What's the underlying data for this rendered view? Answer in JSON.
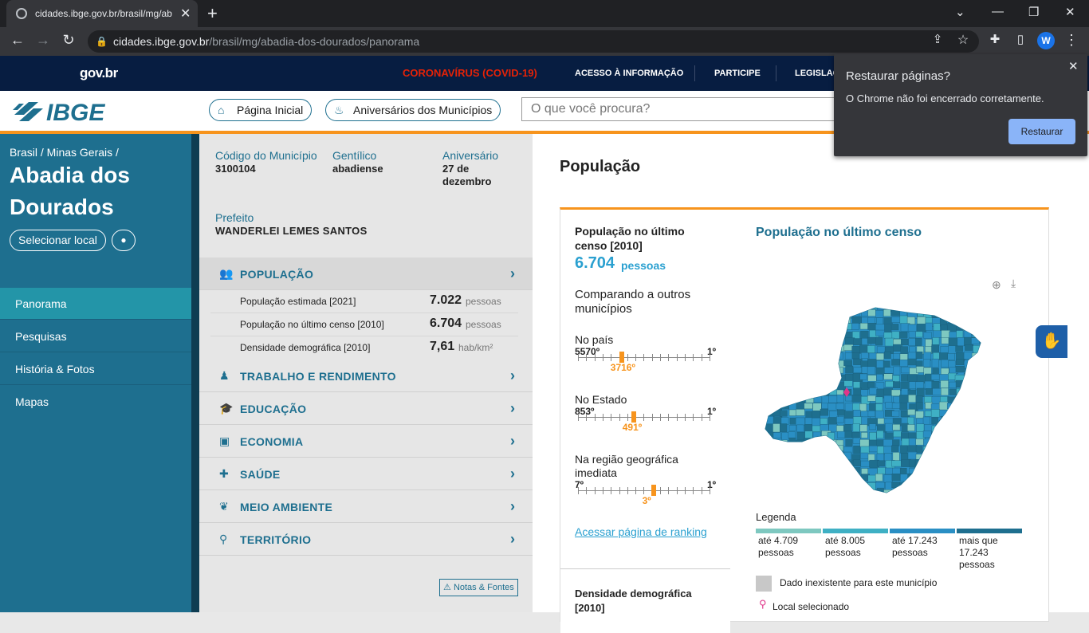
{
  "browser": {
    "tab_title": "cidades.ibge.gov.br/brasil/mg/ab",
    "url_host": "cidades.ibge.gov.br",
    "url_path": "/brasil/mg/abadia-dos-dourados/panorama",
    "profile_letter": "W"
  },
  "gov": {
    "logo": "gov.br",
    "links": [
      "CORONAVÍRUS (COVID-19)",
      "ACESSO À INFORMAÇÃO",
      "PARTICIPE",
      "LEGISLAÇ"
    ]
  },
  "header": {
    "logo": "IBGE",
    "home": "Página Inicial",
    "aniversarios": "Aniversários dos Municípios",
    "search_placeholder": "O que você procura?"
  },
  "sidebar": {
    "breadcrumb": "Brasil / Minas Gerais /",
    "city": "Abadia dos Dourados",
    "select_local": "Selecionar local",
    "items": [
      "Panorama",
      "Pesquisas",
      "História & Fotos",
      "Mapas"
    ]
  },
  "info": {
    "codigo_label": "Código do Município",
    "codigo": "3100104",
    "gentilico_label": "Gentílico",
    "gentilico": "abadiense",
    "aniversario_label": "Aniversário",
    "aniversario": "27 de dezembro",
    "prefeito_label": "Prefeito",
    "prefeito": "WANDERLEI LEMES SANTOS"
  },
  "categories": [
    "POPULAÇÃO",
    "TRABALHO E RENDIMENTO",
    "EDUCAÇÃO",
    "ECONOMIA",
    "SAÚDE",
    "MEIO AMBIENTE",
    "TERRITÓRIO"
  ],
  "populacao_rows": [
    {
      "label": "População estimada [2021]",
      "value": "7.022",
      "unit": "pessoas"
    },
    {
      "label": "População no último censo [2010]",
      "value": "6.704",
      "unit": "pessoas"
    },
    {
      "label": "Densidade demográfica [2010]",
      "value": "7,61",
      "unit": "hab/km²"
    }
  ],
  "notas": "Notas & Fontes",
  "main": {
    "title": "População",
    "card_title": "População no último censo [2010]",
    "card_value": "6.704",
    "card_unit": "pessoas",
    "comparando": "Comparando a outros municípios",
    "rankings": [
      {
        "label": "No país",
        "max": "5570º",
        "min": "1º",
        "pos": "3716º",
        "frac": 0.33
      },
      {
        "label": "No Estado",
        "max": "853º",
        "min": "1º",
        "pos": "491º",
        "frac": 0.42
      },
      {
        "label": "Na região geográfica imediata",
        "max": "7º",
        "min": "1º",
        "pos": "3º",
        "frac": 0.57
      }
    ],
    "ranking_link": "Acessar página de ranking",
    "densidade_title": "Densidade demográfica [2010]",
    "map_title": "População no último censo",
    "legend_title": "Legenda",
    "legend": [
      {
        "text": "até 4.709 pessoas",
        "color": "#7ec8c0"
      },
      {
        "text": "até 8.005 pessoas",
        "color": "#3fb0c4"
      },
      {
        "text": "até 17.243 pessoas",
        "color": "#2a8fc4"
      },
      {
        "text": "mais que 17.243 pessoas",
        "color": "#1e6f8f"
      }
    ],
    "no_data": "Dado inexistente para este município",
    "local_sel": "Local selecionado"
  },
  "popup": {
    "title": "Restaurar páginas?",
    "body": "O Chrome não foi encerrado corretamente.",
    "button": "Restaurar"
  }
}
